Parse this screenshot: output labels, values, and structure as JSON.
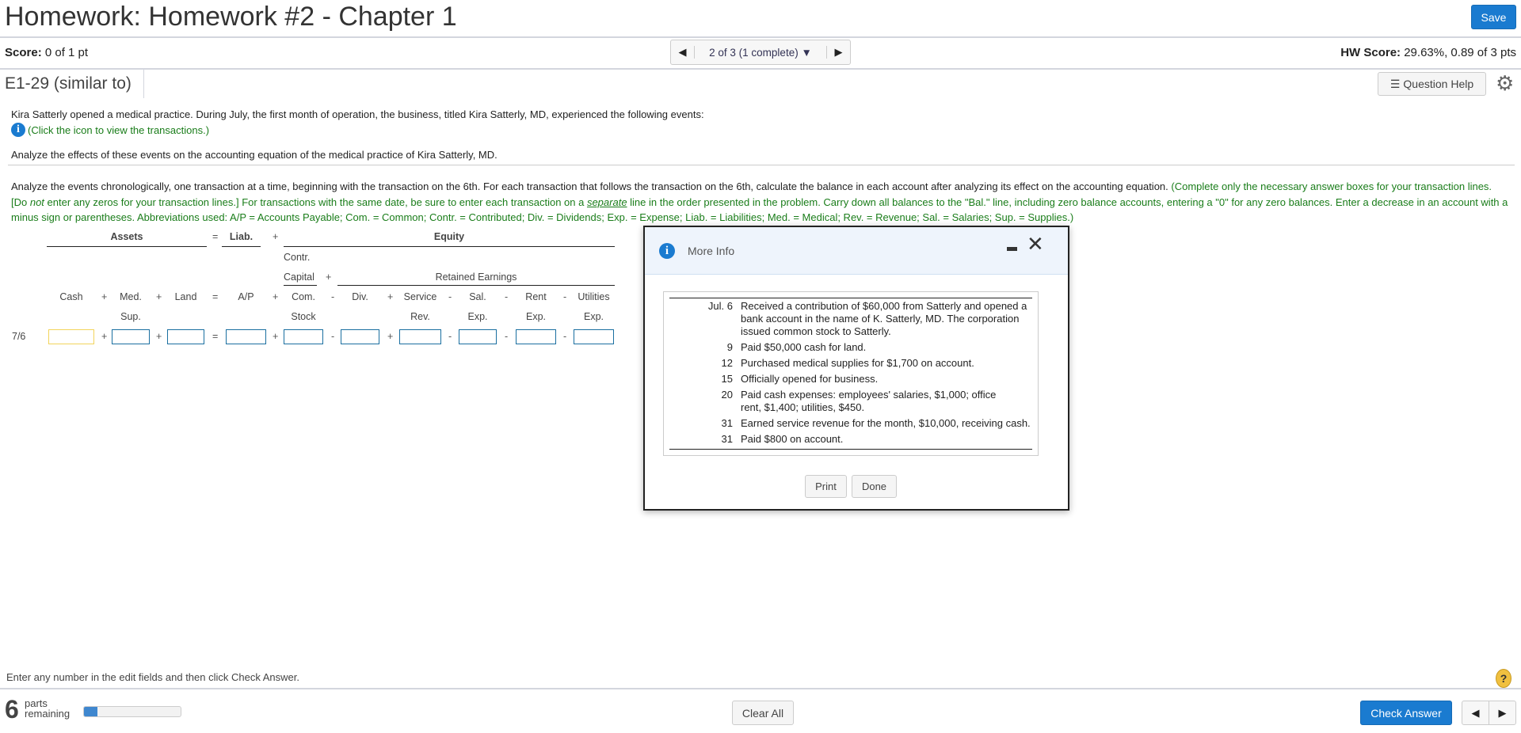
{
  "header": {
    "title": "Homework: Homework #2 - Chapter 1",
    "save_label": "Save"
  },
  "scorebar": {
    "score_label": "Score:",
    "score_value": "0 of 1 pt",
    "nav_text": "2 of 3 (1 complete)",
    "hw_score_label": "HW Score:",
    "hw_score_value": "29.63%, 0.89 of 3 pts"
  },
  "question": {
    "id": "E1-29 (similar to)",
    "help_label": "Question Help"
  },
  "problem": {
    "intro": "Kira Satterly opened a medical practice. During July, the first month of operation, the business, titled Kira Satterly, MD, experienced the following events:",
    "click_icon": "(Click the icon to view the transactions.)",
    "analyze": "Analyze the effects of these events on the accounting equation of the medical practice of Kira Satterly, MD.",
    "instr_black": "Analyze the events chronologically, one transaction at a time, beginning with the transaction on the 6th. For each transaction that follows the transaction on the 6th, calculate the balance in each account after analyzing its effect on the accounting equation.",
    "instr_green_1": "(Complete only the necessary answer boxes for your transaction lines. [Do ",
    "instr_green_not": "not",
    "instr_green_2": " enter any zeros for your transaction lines.] For transactions with the same date, be sure to enter each transaction on a ",
    "instr_green_separate": "separate",
    "instr_green_3": " line in the order presented in the problem. Carry down all balances to the \"Bal.\" line, including zero balance accounts, entering a \"0\" for any zero balances. Enter a decrease in an account with a minus sign or parentheses. Abbreviations used: A/P = Accounts Payable; Com. = Common; Contr. = Contributed; Div. = Dividends; Exp. = Expense; Liab. = Liabilities; Med. = Medical; Rev. = Revenue; Sal. = Salaries; Sup. = Supplies.)"
  },
  "table": {
    "assets": "Assets",
    "liab": "Liab.",
    "equity": "Equity",
    "contr": "Contr.",
    "capital": "Capital",
    "retained": "Retained Earnings",
    "plus": "+",
    "minus": "-",
    "equals": "=",
    "cols": [
      {
        "l1": "Cash",
        "l2": ""
      },
      {
        "l1": "Med.",
        "l2": "Sup."
      },
      {
        "l1": "Land",
        "l2": ""
      },
      {
        "l1": "A/P",
        "l2": ""
      },
      {
        "l1": "Com.",
        "l2": "Stock"
      },
      {
        "l1": "Div.",
        "l2": ""
      },
      {
        "l1": "Service",
        "l2": "Rev."
      },
      {
        "l1": "Sal.",
        "l2": "Exp."
      },
      {
        "l1": "Rent",
        "l2": "Exp."
      },
      {
        "l1": "Utilities",
        "l2": "Exp."
      }
    ],
    "row_label": "7/6"
  },
  "modal": {
    "title": "More Info",
    "transactions": [
      {
        "date": "Jul. 6",
        "text": "Received a contribution of $60,000 from Satterly and opened a bank account in the name of K. Satterly, MD. The corporation issued common stock to Satterly."
      },
      {
        "date": "9",
        "text": "Paid $50,000 cash for land."
      },
      {
        "date": "12",
        "text": "Purchased medical supplies for $1,700 on account."
      },
      {
        "date": "15",
        "text": "Officially opened for business."
      },
      {
        "date": "20",
        "text": "Paid cash expenses: employees' salaries, $1,000; office rent, $1,400; utilities, $450."
      },
      {
        "date": "31",
        "text": "Earned service revenue for the month, $10,000, receiving cash."
      },
      {
        "date": "31",
        "text": "Paid $800 on account."
      }
    ],
    "print_label": "Print",
    "done_label": "Done"
  },
  "footer": {
    "hint": "Enter any number in the edit fields and then click Check Answer.",
    "parts_number": "6",
    "parts_label_1": "parts",
    "parts_label_2": "remaining",
    "progress_fraction": 0.14,
    "clear_all": "Clear All",
    "check_answer": "Check Answer"
  },
  "colors": {
    "accent": "#1a7bd0",
    "green": "#1a7d1a",
    "help": "#f0c040"
  }
}
